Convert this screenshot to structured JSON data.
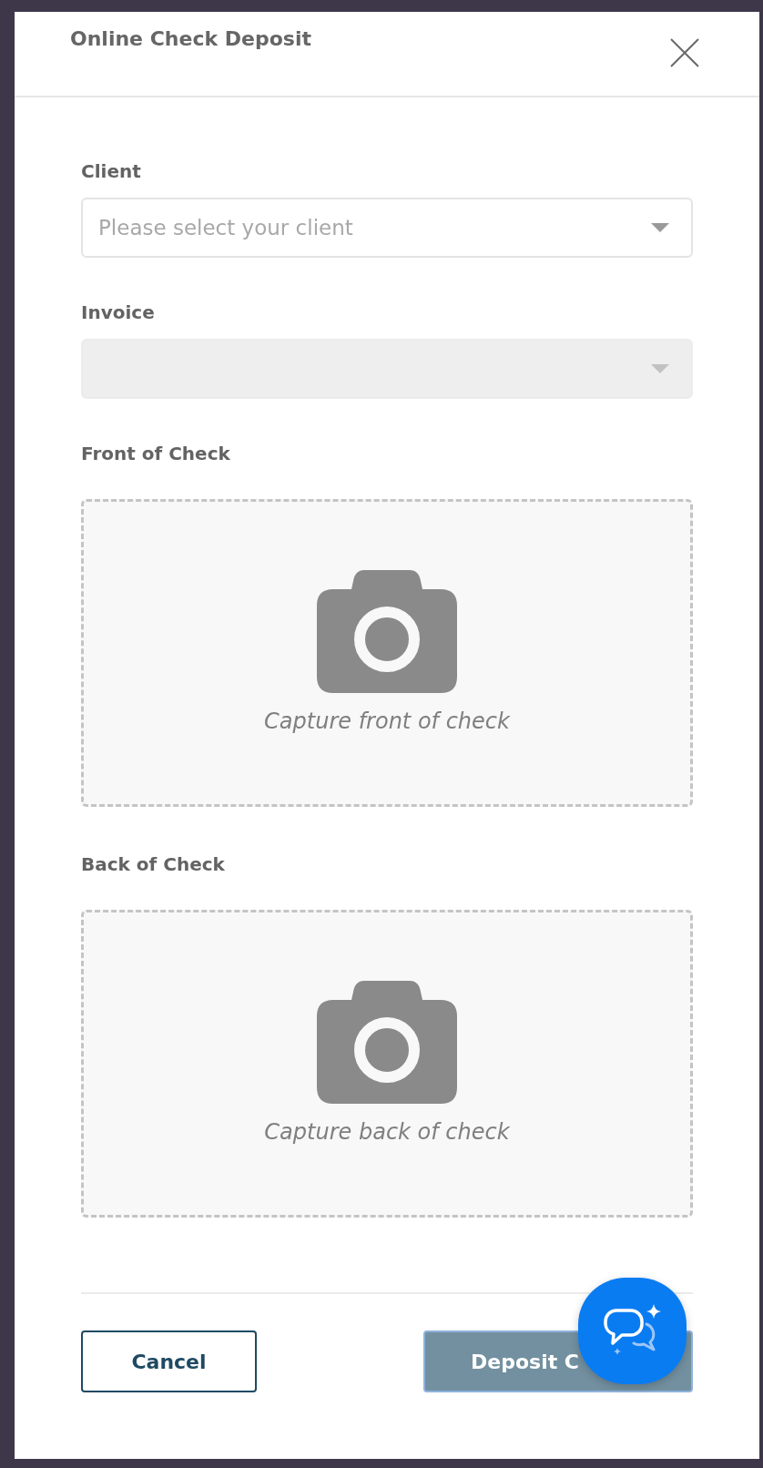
{
  "dialog": {
    "title": "Online Check Deposit"
  },
  "fields": [
    {
      "label": "Client",
      "placeholder": "Please select your client",
      "disabled": false
    },
    {
      "label": "Invoice",
      "disabled": true
    }
  ],
  "uploads": [
    {
      "label": "Front of Check",
      "prompt": "Capture front of check"
    },
    {
      "label": "Back of Check",
      "prompt": "Capture back of check"
    }
  ],
  "buttons": [
    {
      "kind": "secondary",
      "label": "Cancel",
      "disabled": false
    },
    {
      "kind": "primary",
      "label": "Deposit C",
      "disabled": true
    }
  ]
}
